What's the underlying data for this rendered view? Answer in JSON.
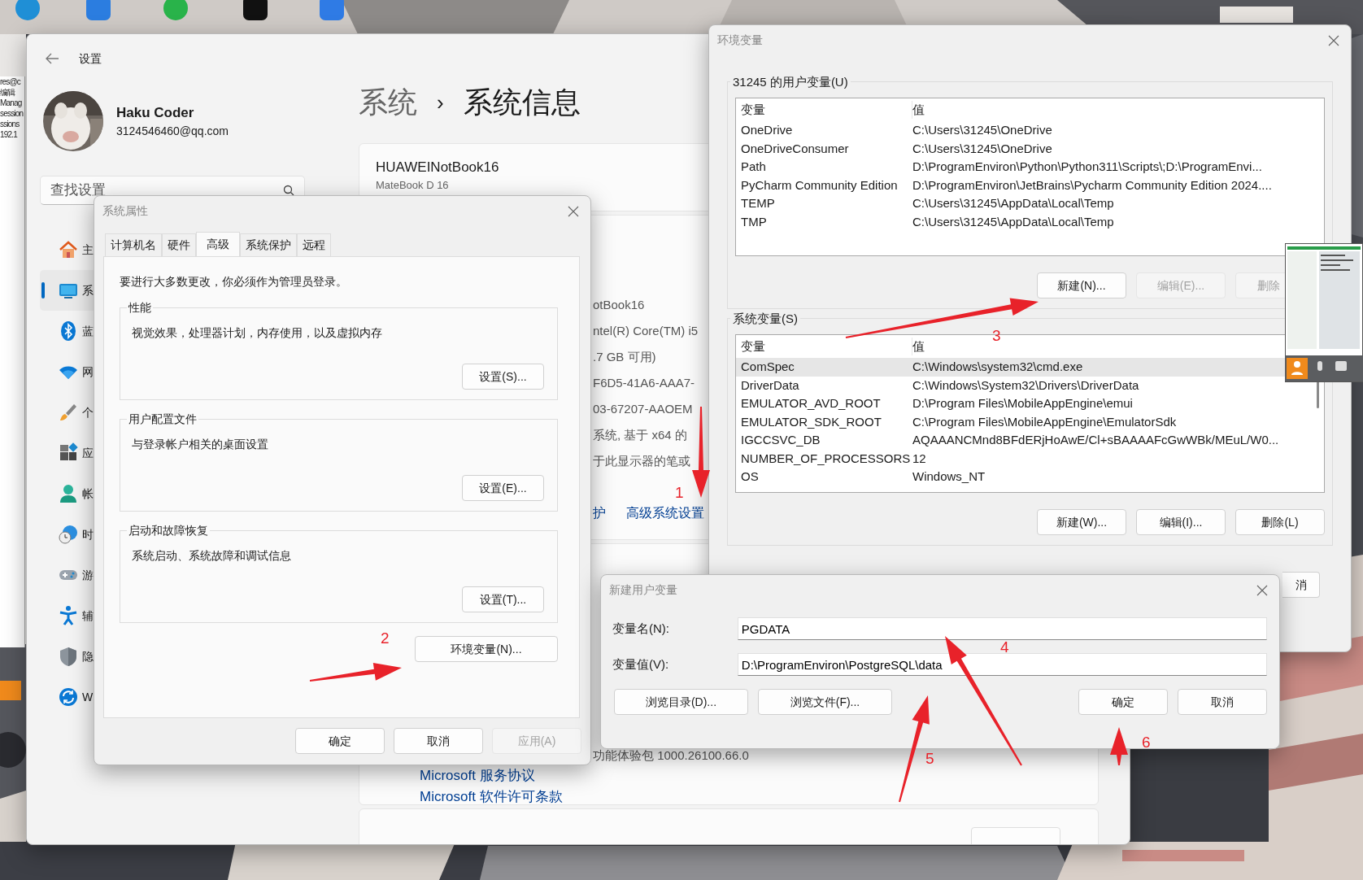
{
  "background_app": {
    "texts": [
      "res@c",
      "编辑",
      "Manag",
      "session",
      "ssions",
      "192.1"
    ]
  },
  "settings": {
    "title": "设置",
    "user": {
      "name": "Haku Coder",
      "email": "3124546460@qq.com"
    },
    "search": {
      "placeholder": "查找设置"
    },
    "nav": [
      {
        "label": "主",
        "selected": false
      },
      {
        "label": "系",
        "selected": true
      },
      {
        "label": "蓝",
        "selected": false
      },
      {
        "label": "网",
        "selected": false
      },
      {
        "label": "个",
        "selected": false
      },
      {
        "label": "应",
        "selected": false
      },
      {
        "label": "帐",
        "selected": false
      },
      {
        "label": "时",
        "selected": false
      },
      {
        "label": "游",
        "selected": false
      },
      {
        "label": "辅",
        "selected": false
      },
      {
        "label": "隐",
        "selected": false
      },
      {
        "label": "W",
        "selected": false
      }
    ],
    "breadcrumb": {
      "parent": "系统",
      "separator": "›",
      "current": "系统信息"
    },
    "device": {
      "name": "HUAWEINotBook16",
      "model": "MateBook D 16"
    },
    "spec_fragments": [
      "otBook16",
      "ntel(R) Core(TM) i5",
      ".7 GB 可用)",
      "F6D5-41A6-AAA7-",
      "03-67207-AAOEM",
      "系统, 基于 x64 的",
      "于此显示器的笔或"
    ],
    "links": [
      "护",
      "高级系统设置"
    ],
    "version_fragment": "功能体验包 1000.26100.66.0",
    "legal_links": [
      "Microsoft 服务协议",
      "Microsoft 软件许可条款"
    ]
  },
  "system_properties": {
    "title": "系统属性",
    "tabs": [
      {
        "label": "计算机名",
        "selected": false
      },
      {
        "label": "硬件",
        "selected": false
      },
      {
        "label": "高级",
        "selected": true
      },
      {
        "label": "系统保护",
        "selected": false
      },
      {
        "label": "远程",
        "selected": false
      }
    ],
    "note": "要进行大多数更改，你必须作为管理员登录。",
    "groups": [
      {
        "legend": "性能",
        "description": "视觉效果，处理器计划，内存使用，以及虚拟内存",
        "button": "设置(S)..."
      },
      {
        "legend": "用户配置文件",
        "description": "与登录帐户相关的桌面设置",
        "button": "设置(E)..."
      },
      {
        "legend": "启动和故障恢复",
        "description": "系统启动、系统故障和调试信息",
        "button": "设置(T)..."
      }
    ],
    "env_button": "环境变量(N)...",
    "footer": [
      {
        "label": "确定",
        "disabled": false
      },
      {
        "label": "取消",
        "disabled": false
      },
      {
        "label": "应用(A)",
        "disabled": true
      }
    ]
  },
  "environment_variables": {
    "title": "环境变量",
    "user_vars": {
      "title": "31245 的用户变量(U)",
      "columns": [
        "变量",
        "值"
      ],
      "rows": [
        {
          "name": "OneDrive",
          "value": "C:\\Users\\31245\\OneDrive",
          "selected": false
        },
        {
          "name": "OneDriveConsumer",
          "value": "C:\\Users\\31245\\OneDrive",
          "selected": false
        },
        {
          "name": "Path",
          "value": "D:\\ProgramEnviron\\Python\\Python311\\Scripts\\;D:\\ProgramEnvi...",
          "selected": false
        },
        {
          "name": "PyCharm Community Edition",
          "value": "D:\\ProgramEnviron\\JetBrains\\Pycharm Community Edition 2024....",
          "selected": false
        },
        {
          "name": "TEMP",
          "value": "C:\\Users\\31245\\AppData\\Local\\Temp",
          "selected": false
        },
        {
          "name": "TMP",
          "value": "C:\\Users\\31245\\AppData\\Local\\Temp",
          "selected": false
        }
      ],
      "buttons": [
        {
          "label": "新建(N)...",
          "disabled": false
        },
        {
          "label": "编辑(E)...",
          "disabled": true
        },
        {
          "label": "删除",
          "disabled": true
        }
      ]
    },
    "system_vars": {
      "title": "系统变量(S)",
      "columns": [
        "变量",
        "值"
      ],
      "rows": [
        {
          "name": "ComSpec",
          "value": "C:\\Windows\\system32\\cmd.exe",
          "selected": true
        },
        {
          "name": "DriverData",
          "value": "C:\\Windows\\System32\\Drivers\\DriverData",
          "selected": false
        },
        {
          "name": "EMULATOR_AVD_ROOT",
          "value": "D:\\Program Files\\MobileAppEngine\\emui",
          "selected": false
        },
        {
          "name": "EMULATOR_SDK_ROOT",
          "value": "C:\\Program Files\\MobileAppEngine\\EmulatorSdk",
          "selected": false
        },
        {
          "name": "IGCCSVC_DB",
          "value": "AQAAANCMnd8BFdERjHoAwE/Cl+sBAAAAFcGwWBk/MEuL/W0...",
          "selected": false
        },
        {
          "name": "NUMBER_OF_PROCESSORS",
          "value": "12",
          "selected": false
        },
        {
          "name": "OS",
          "value": "Windows_NT",
          "selected": false
        }
      ],
      "buttons": [
        {
          "label": "新建(W)...",
          "disabled": false
        },
        {
          "label": "编辑(I)...",
          "disabled": false
        },
        {
          "label": "删除(L)",
          "disabled": false
        }
      ]
    },
    "partial_button": "消"
  },
  "new_variable": {
    "title": "新建用户变量",
    "fields": [
      {
        "label": "变量名(N):",
        "value": "PGDATA"
      },
      {
        "label": "变量值(V):",
        "value": "D:\\ProgramEnviron\\PostgreSQL\\data"
      }
    ],
    "buttons": [
      {
        "label": "浏览目录(D)...",
        "kind": "left"
      },
      {
        "label": "浏览文件(F)...",
        "kind": "left"
      },
      {
        "label": "确定",
        "kind": "right"
      },
      {
        "label": "取消",
        "kind": "right"
      }
    ]
  },
  "annotations": [
    {
      "label": "1"
    },
    {
      "label": "2"
    },
    {
      "label": "3"
    },
    {
      "label": "4"
    },
    {
      "label": "5"
    },
    {
      "label": "6"
    }
  ]
}
